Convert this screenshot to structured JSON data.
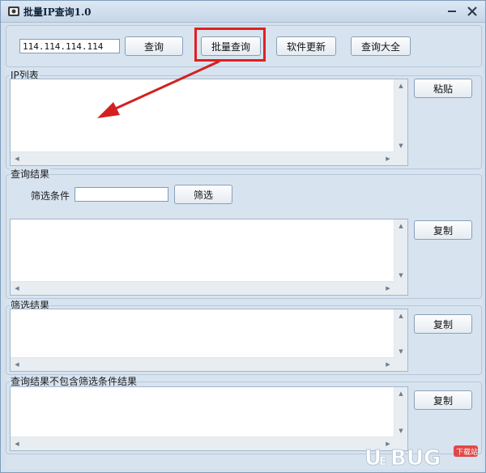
{
  "window": {
    "title": "批量IP查询1.0"
  },
  "toolbar": {
    "ip_value": "114.114.114.114",
    "query_label": "查询",
    "batch_query_label": "批量查询",
    "software_update_label": "软件更新",
    "query_all_label": "查询大全"
  },
  "ip_list": {
    "title": "IP列表",
    "paste_label": "粘贴"
  },
  "query_result": {
    "title": "查询结果",
    "filter_label": "筛选条件",
    "filter_value": "",
    "filter_button_label": "筛选",
    "copy_label": "复制"
  },
  "filter_result": {
    "title": "筛选结果",
    "copy_label": "复制"
  },
  "excluded_result": {
    "title": "查询结果不包含筛选条件结果",
    "copy_label": "复制"
  },
  "watermark": {
    "brand": "UEBUG",
    "sub": "下载站"
  },
  "colors": {
    "highlight": "#e02020",
    "accent_arrow": "#d42020"
  }
}
